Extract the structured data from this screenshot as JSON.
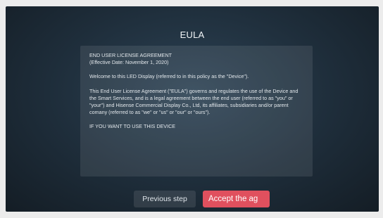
{
  "dialog": {
    "title": "EULA",
    "paragraphs": [
      "END USER LICENSE AGREEMENT\n(Effective Date: November 1, 2020)",
      "Welcome to this LED Display (referred to in this policy as the \"Device\").",
      "This End User License Agreement (\"EULA\") governs and regulates the use of the Device and the Smart Services, and is a legal agreement between the end user (referred to as \"you\" or \"your\") and Hisense Commercial Display Co., Ltd, its affiliates, subsidiaries and/or parent comany (referred to as \"we\" or \"us\" or \"our\" or \"ours\").",
      "IF YOU WANT TO USE THIS DEVICE"
    ]
  },
  "buttons": {
    "previous_label": "Previous step",
    "accept_label": "Accept the ag"
  },
  "colors": {
    "background": "#1e2d3a",
    "accept_button": "#e0505e"
  }
}
